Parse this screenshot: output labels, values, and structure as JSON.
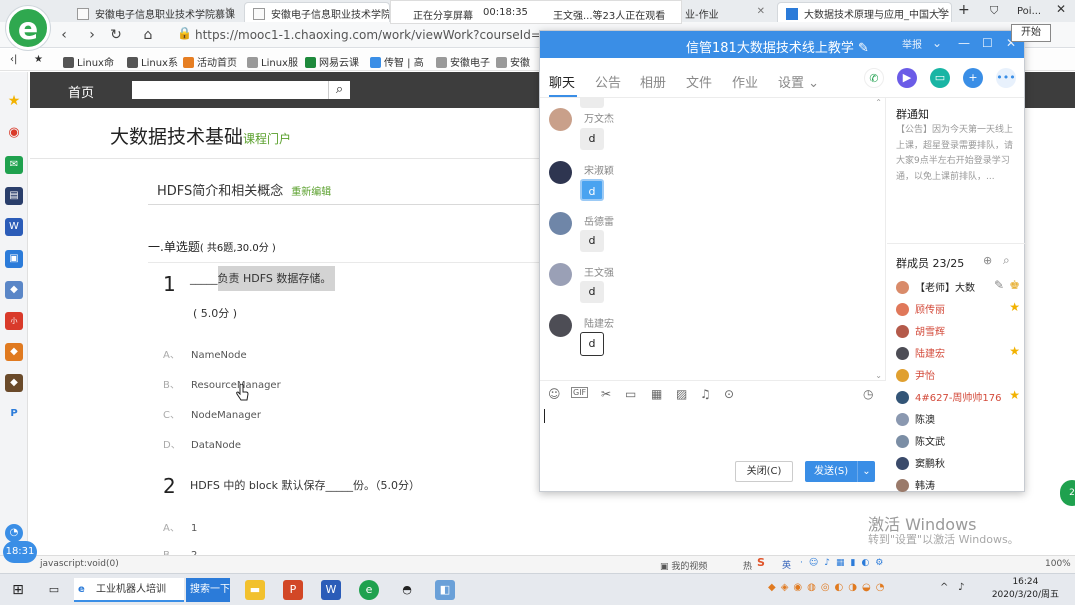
{
  "browser": {
    "logo_letter": "e",
    "tabs": [
      {
        "title": "安徽电子信息职业技术学院慕课"
      },
      {
        "title": "安徽电子信息职业技术学院"
      },
      {
        "title": "业-作业"
      },
      {
        "title": "大数据技术原理与应用_中国大学"
      },
      {
        "title": "Poi..."
      }
    ],
    "new_tab": "+",
    "share": {
      "status": "正在分享屏幕",
      "elapsed": "00:18:35",
      "watchers": "王文强...等23人正在观看"
    },
    "start_button": "开始",
    "url": "https://mooc1-1.chaoxing.com/work/viewWork?courseId=20",
    "bookmarks": [
      "Linux命",
      "Linux系",
      "活动首页",
      "Linux服",
      "网易云课",
      "传智 | 高",
      "安徽电子",
      "安徽"
    ],
    "sidebar_icons": [
      "favorites-star",
      "weibo",
      "mail",
      "news",
      "word",
      "ad",
      "game",
      "game2",
      "mini",
      "game3",
      "game4",
      "app"
    ]
  },
  "page": {
    "nav_home": "首页",
    "search_placeholder": "",
    "course_title": "大数据技术基础",
    "course_portal": "课程门户",
    "chapter_title": "HDFS简介和相关概念",
    "re_edit": "重新编辑",
    "section_title": "一.单选题",
    "section_meta": "( 共6题,30.0分 )",
    "questions": [
      {
        "num": "1",
        "blank": "_____",
        "text": "负责 HDFS 数据存储。",
        "score": "( 5.0分 )",
        "options": [
          {
            "letter": "A、",
            "text": "NameNode"
          },
          {
            "letter": "B、",
            "text": "ResourceManager"
          },
          {
            "letter": "C、",
            "text": "NodeManager"
          },
          {
            "letter": "D、",
            "text": "DataNode"
          }
        ]
      },
      {
        "num": "2",
        "text": "HDFS 中的 block 默认保存_____份。（5.0分）",
        "options": [
          {
            "letter": "A、",
            "text": "1"
          },
          {
            "letter": "B、",
            "text": "2"
          }
        ]
      }
    ],
    "windows_activate": "激活 Windows",
    "windows_activate_sub": "转到\"设置\"以激活 Windows。"
  },
  "chat": {
    "title": "信管181大数据技术线上教学",
    "title_extra": "举报",
    "tabs": [
      "聊天",
      "公告",
      "相册",
      "文件",
      "作业",
      "设置"
    ],
    "messages": [
      {
        "name": "万文杰",
        "text": "d",
        "avatar_color": "#c9a08a"
      },
      {
        "name": "宋淑颖",
        "text": "d",
        "avatar_color": "#2e3550",
        "selected": true
      },
      {
        "name": "岳德雷",
        "text": "d",
        "avatar_color": "#6f86a8"
      },
      {
        "name": "王文强",
        "text": "d",
        "avatar_color": "#9aa0b6"
      },
      {
        "name": "陆建宏",
        "text": "d",
        "avatar_color": "#4d4d55",
        "outlined": true
      }
    ],
    "close_label": "关闭(C)",
    "send_label": "发送(S)",
    "notice_heading": "群通知",
    "notice_text": "【公告】因为今天第一天线上上课，超星登录需要排队，请大家9点半左右开始登录学习通，以免上课前排队，...",
    "members_heading": "群成员 23/25",
    "members": [
      {
        "name": "【老师】大数",
        "color": "#222",
        "dot": "#d98b6a",
        "star": false
      },
      {
        "name": "顾传丽",
        "color": "#d34a3a",
        "dot": "#e0785a",
        "star": true
      },
      {
        "name": "胡雪辉",
        "color": "#d34a3a",
        "dot": "#b45a4a",
        "star": false
      },
      {
        "name": "陆建宏",
        "color": "#d34a3a",
        "dot": "#4d4d55",
        "star": true
      },
      {
        "name": "尹怡",
        "color": "#d34a3a",
        "dot": "#e0a030",
        "star": false
      },
      {
        "name": "4#627-周帅帅176",
        "color": "#d34a3a",
        "dot": "#335577",
        "star": true
      },
      {
        "name": "陈澳",
        "color": "#222",
        "dot": "#8a98b0",
        "star": false
      },
      {
        "name": "陈文武",
        "color": "#222",
        "dot": "#7b8ea5",
        "star": false
      },
      {
        "name": "窦鹏秋",
        "color": "#222",
        "dot": "#3a4a6a",
        "star": false
      },
      {
        "name": "韩涛",
        "color": "#222",
        "dot": "#9a7a6a",
        "star": false
      }
    ]
  },
  "status": {
    "left": "javascript:void(0)",
    "myvideo": "我的视频",
    "hot": "热",
    "zoom": "100%",
    "clock_badge": "18:31"
  },
  "taskbar": {
    "apps": [
      "工业机器人培训",
      "搜索一下"
    ],
    "ime": "英",
    "time": "16:24",
    "date": "2020/3/20/周五"
  }
}
